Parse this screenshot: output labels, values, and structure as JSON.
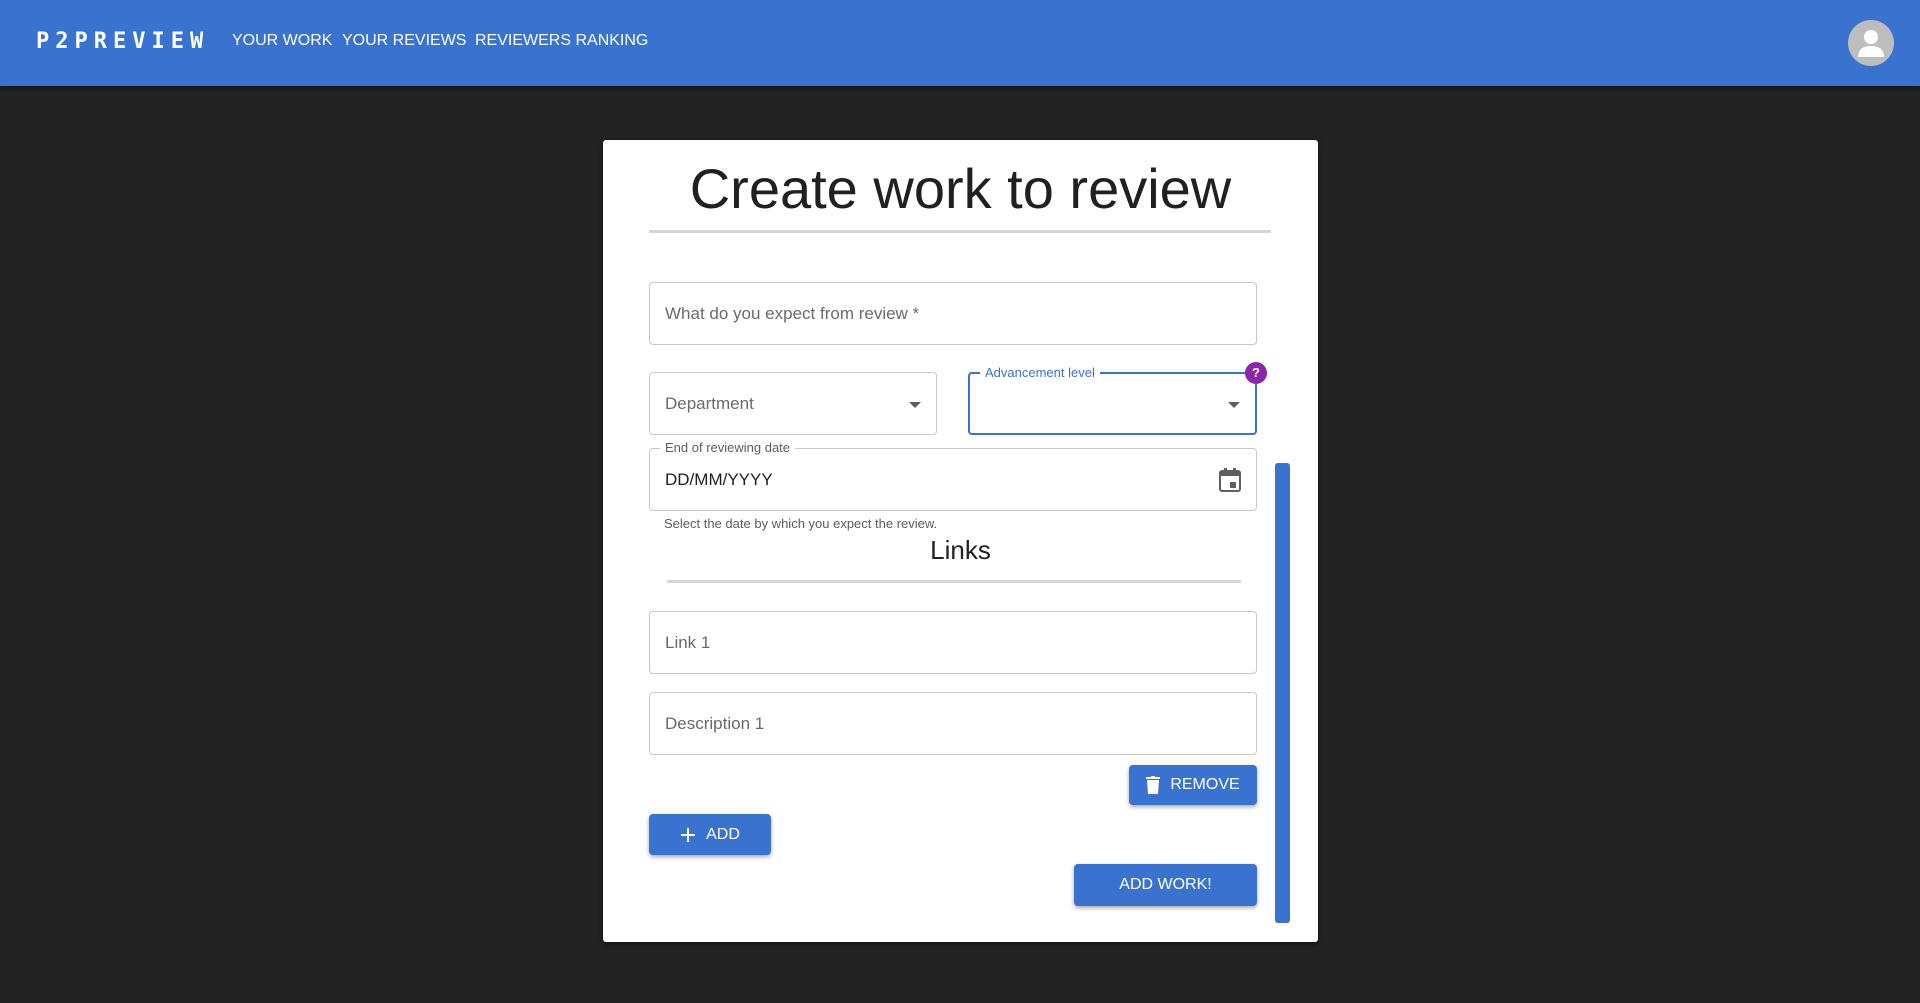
{
  "app": {
    "brand": "P2PREVIEW",
    "nav": [
      {
        "label": "YOUR WORK"
      },
      {
        "label": "YOUR REVIEWS"
      },
      {
        "label": "REVIEWERS RANKING"
      }
    ]
  },
  "form": {
    "title": "Create work to review",
    "expectation": {
      "placeholder": "What do you expect from review *"
    },
    "department": {
      "placeholder": "Department"
    },
    "advancement": {
      "label": "Advancement level",
      "help": "?"
    },
    "date": {
      "label": "End of reviewing date",
      "value": "DD/MM/YYYY",
      "helper": "Select the date by which you expect the review."
    },
    "links": {
      "title": "Links",
      "items": [
        {
          "link_placeholder": "Link 1",
          "description_placeholder": "Description 1",
          "remove_label": "REMOVE"
        }
      ]
    },
    "add_label": "ADD",
    "submit_label": "ADD WORK!"
  },
  "colors": {
    "primary": "#3a73cf",
    "background": "#232323",
    "help_badge": "#8e24aa"
  },
  "icons": [
    "account-icon",
    "dropdown-arrow-icon",
    "calendar-icon",
    "delete-icon",
    "plus-icon"
  ]
}
